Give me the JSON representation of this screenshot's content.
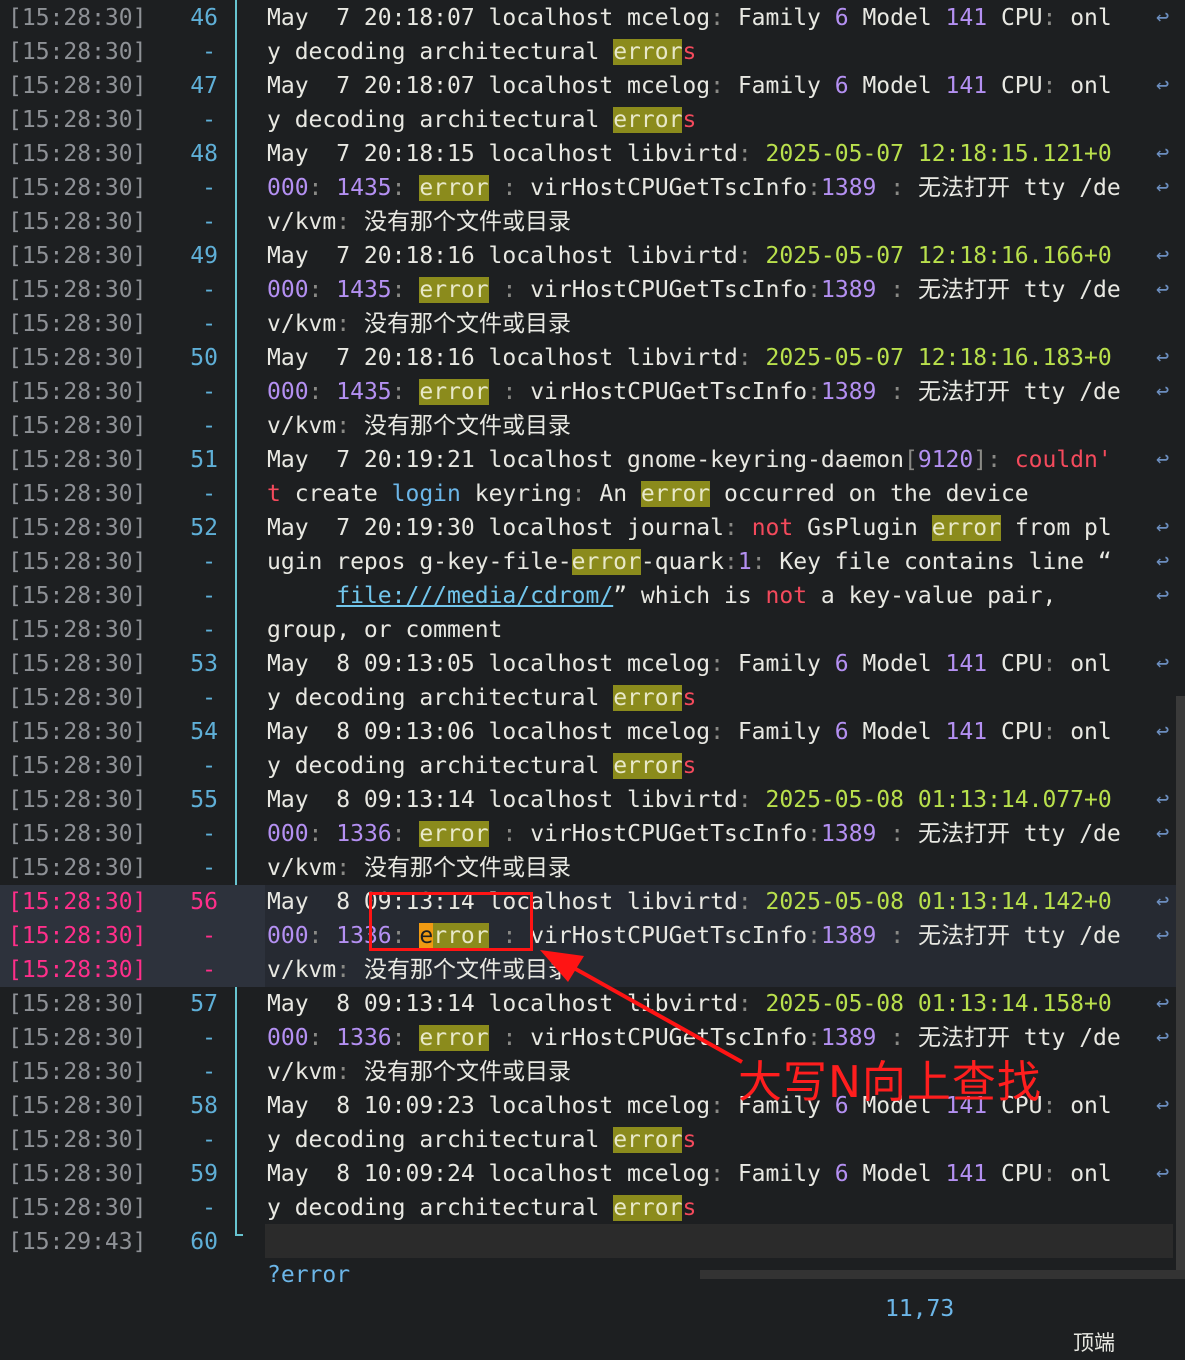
{
  "terminal": {
    "timestamp": "[15:28:30]",
    "last_timestamp": "[15:29:43]",
    "continuation_marker": "-",
    "wrap_marker": "↩"
  },
  "colors": {
    "background": "#1d1f21",
    "search_highlight": "#8b8b1c",
    "cursor": "#f09a12",
    "annotation": "#ff1414"
  },
  "status_line": {
    "command": "?error",
    "cursor_position": "11,73",
    "scroll_position": "顶端"
  },
  "annotation": {
    "text": "大写N向上查找"
  }
}
